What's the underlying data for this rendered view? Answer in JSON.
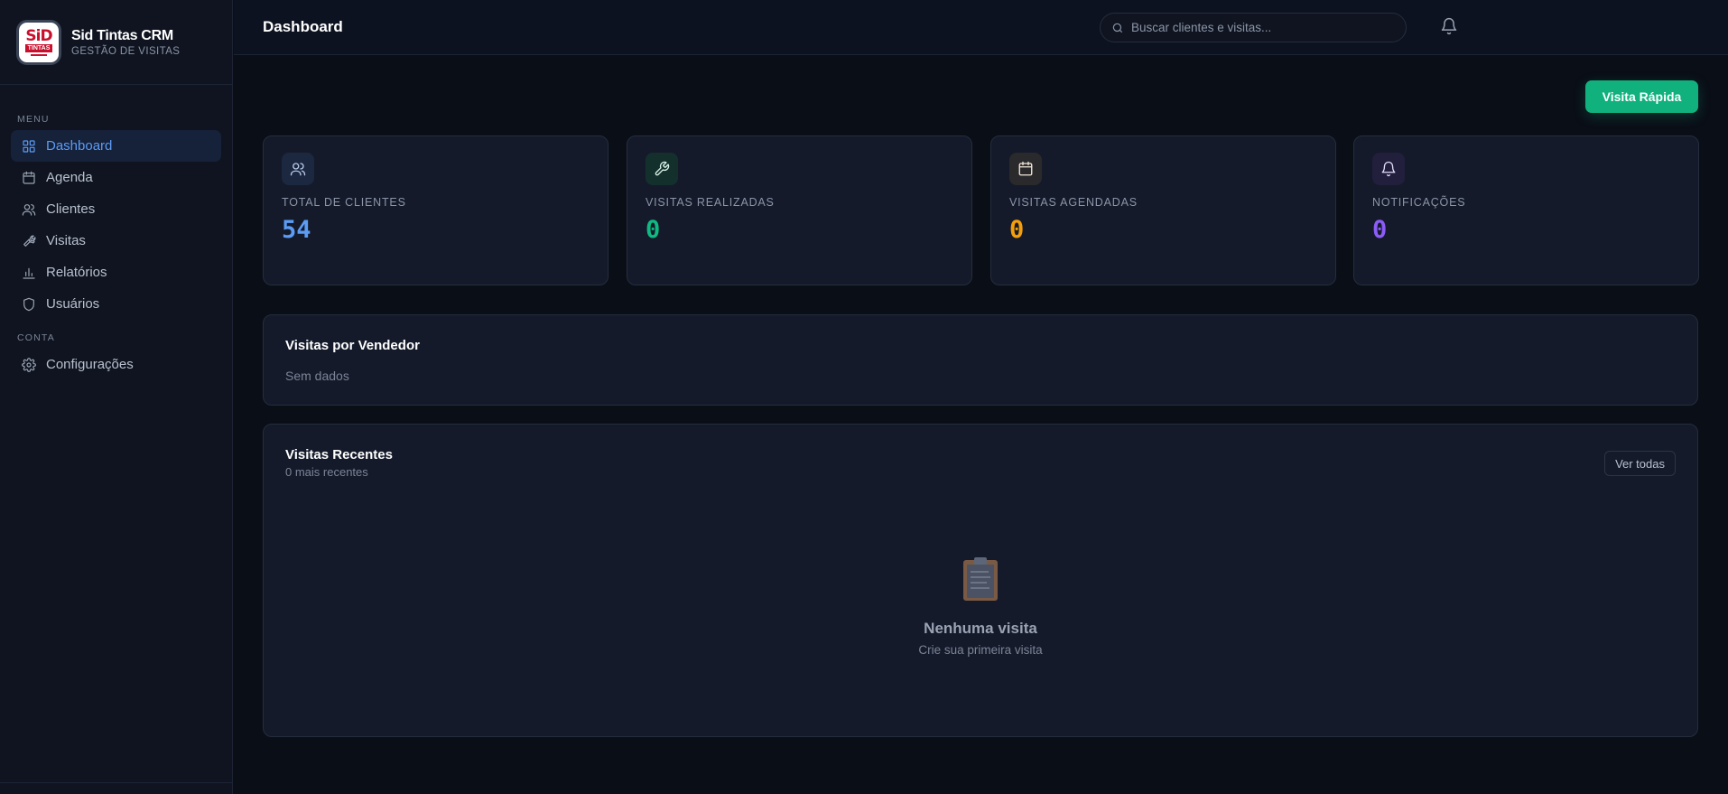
{
  "brand": {
    "title": "Sid Tintas CRM",
    "subtitle": "GESTÃO DE VISITAS",
    "logo_top": "SiD",
    "logo_mid": "TINTAS"
  },
  "sidebar": {
    "menu_label": "MENU",
    "items": [
      {
        "label": "Dashboard",
        "icon": "grid-icon",
        "active": true
      },
      {
        "label": "Agenda",
        "icon": "calendar-icon"
      },
      {
        "label": "Clientes",
        "icon": "users-icon"
      },
      {
        "label": "Visitas",
        "icon": "wrench-icon"
      },
      {
        "label": "Relatórios",
        "icon": "bar-chart-icon"
      },
      {
        "label": "Usuários",
        "icon": "shield-icon"
      }
    ],
    "account_label": "CONTA",
    "account_items": [
      {
        "label": "Configurações",
        "icon": "gear-icon"
      }
    ]
  },
  "header": {
    "title": "Dashboard",
    "search_placeholder": "Buscar clientes e visitas...",
    "notifications_icon": "bell-icon"
  },
  "main": {
    "quick_visit_label": "Visita Rápida",
    "stats": [
      {
        "label": "TOTAL DE CLIENTES",
        "value": "54",
        "icon": "users-icon",
        "color": "#5b9cf5",
        "icon_bg": "#1c2840"
      },
      {
        "label": "VISITAS REALIZADAS",
        "value": "0",
        "icon": "wrench-icon",
        "color": "#10b981",
        "icon_bg": "#13302d"
      },
      {
        "label": "VISITAS AGENDADAS",
        "value": "0",
        "icon": "calendar-icon",
        "color": "#f59e0b",
        "icon_bg": "#2a2a2c"
      },
      {
        "label": "NOTIFICAÇÕES",
        "value": "0",
        "icon": "bell-icon",
        "color": "#8b5cf6",
        "icon_bg": "#221f3d"
      }
    ],
    "by_seller": {
      "title": "Visitas por Vendedor",
      "empty_text": "Sem dados"
    },
    "recent": {
      "title": "Visitas Recentes",
      "subtitle": "0 mais recentes",
      "see_all_label": "Ver todas",
      "empty_icon": "clipboard-icon",
      "empty_title": "Nenhuma visita",
      "empty_subtitle": "Crie sua primeira visita"
    }
  }
}
